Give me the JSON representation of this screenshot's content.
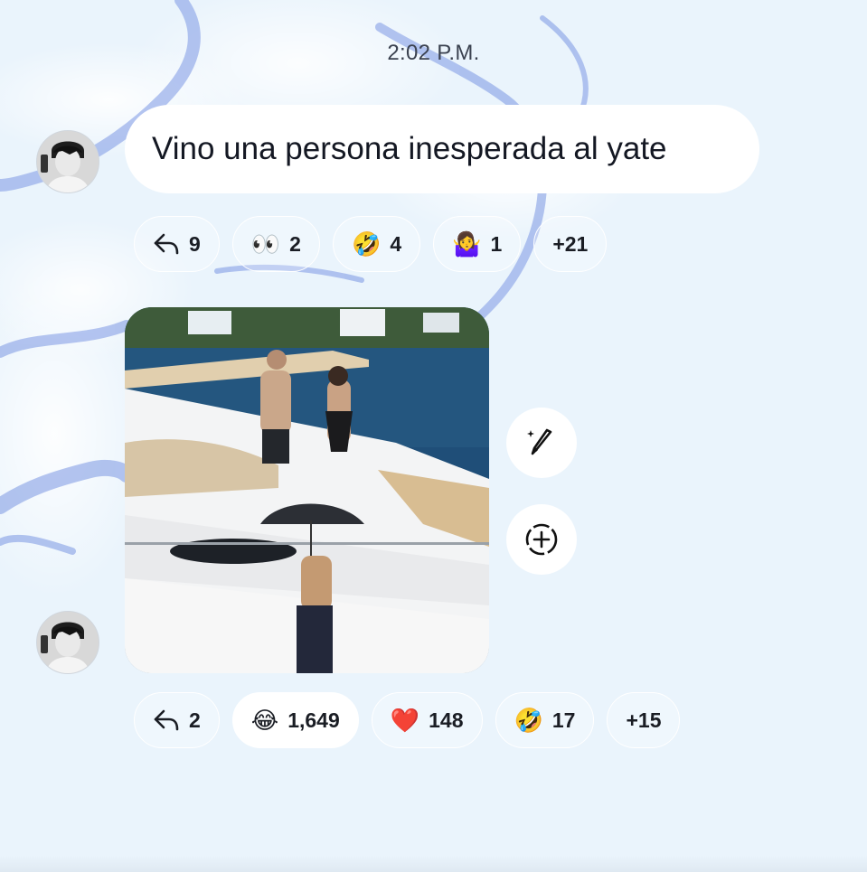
{
  "timestamp": "2:02 P.M.",
  "colors": {
    "background": "#eaf4fc",
    "bubble": "#ffffff",
    "cloud_blue": "#6f8ee0",
    "text": "#141823"
  },
  "messages": [
    {
      "sender_avatar": "avatar-icon",
      "text": "Vino una persona inesperada al yate",
      "reactions": [
        {
          "icon": "reply-icon",
          "emoji": "",
          "count": "9"
        },
        {
          "icon": "eyes-emoji",
          "emoji": "👀",
          "count": "2"
        },
        {
          "icon": "rolling-laughing-emoji",
          "emoji": "🤣",
          "count": "4"
        },
        {
          "icon": "person-shrugging-emoji",
          "emoji": "🤷‍♀️",
          "count": "1"
        },
        {
          "icon": "more-reactions",
          "emoji": "",
          "count": "+21"
        }
      ]
    },
    {
      "sender_avatar": "avatar-icon",
      "media": "photo",
      "actions": [
        "edit-sparkle-icon",
        "add-circle-icon"
      ],
      "reactions": [
        {
          "icon": "reply-icon",
          "emoji": "",
          "count": "2"
        },
        {
          "icon": "tears-of-joy-emoji",
          "emoji": "😂",
          "count": "1,649",
          "highlighted": true
        },
        {
          "icon": "red-heart-emoji",
          "emoji": "❤️",
          "count": "148"
        },
        {
          "icon": "rolling-laughing-emoji",
          "emoji": "🤣",
          "count": "17"
        },
        {
          "icon": "more-reactions",
          "emoji": "",
          "count": "+15"
        }
      ]
    }
  ]
}
